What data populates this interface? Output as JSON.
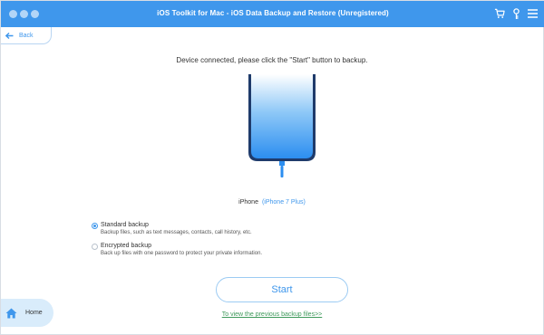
{
  "window": {
    "title": "iOS Toolkit for Mac - iOS Data Backup and Restore (Unregistered)",
    "toolbar_icons": [
      "cart-icon",
      "key-icon",
      "menu-icon"
    ]
  },
  "nav": {
    "back_label": "Back",
    "home_label": "Home"
  },
  "main": {
    "instruction": "Device connected, please click the \"Start\" button to backup.",
    "device_name": "iPhone",
    "device_model": "(iPhone 7 Plus)",
    "options": [
      {
        "title": "Standard backup",
        "description": "Backup files, such as text messages, contacts, call history, etc.",
        "selected": true
      },
      {
        "title": "Encrypted backup",
        "description": "Back up files with one password to protect your private information.",
        "selected": false
      }
    ],
    "start_label": "Start",
    "previous_link": "To view the previous backup files>>"
  },
  "colors": {
    "accent": "#3f97ec",
    "link_green": "#3f9a5c",
    "home_bg": "#d9ecfb"
  }
}
